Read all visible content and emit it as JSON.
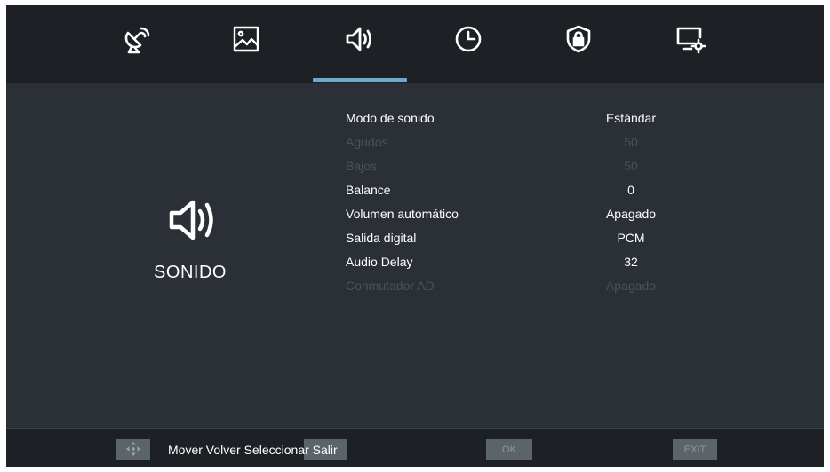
{
  "tabs": [
    {
      "icon": "satellite-dish-icon",
      "selected": false
    },
    {
      "icon": "picture-icon",
      "selected": false
    },
    {
      "icon": "speaker-icon",
      "selected": true
    },
    {
      "icon": "clock-icon",
      "selected": false
    },
    {
      "icon": "shield-lock-icon",
      "selected": false
    },
    {
      "icon": "monitor-settings-icon",
      "selected": false
    }
  ],
  "section": {
    "icon": "speaker-icon",
    "title": "SONIDO"
  },
  "menu": {
    "items": [
      {
        "label": "Modo de sonido",
        "value": "Estándar",
        "enabled": true
      },
      {
        "label": "Agudos",
        "value": "50",
        "enabled": false
      },
      {
        "label": "Bajos",
        "value": "50",
        "enabled": false
      },
      {
        "label": "Balance",
        "value": "0",
        "enabled": true
      },
      {
        "label": "Volumen automático",
        "value": "Apagado",
        "enabled": true
      },
      {
        "label": "Salida digital",
        "value": "PCM",
        "enabled": true
      },
      {
        "label": "Audio Delay",
        "value": "32",
        "enabled": true
      },
      {
        "label": "Conmutador AD",
        "value": "Apagado",
        "enabled": false
      }
    ]
  },
  "footer": {
    "hint_text": "Mover Volver  Seleccionar Salir",
    "ok_key": "OK",
    "exit_key": "EXIT"
  },
  "colors": {
    "background": "#2a3036",
    "bar": "#1d2126",
    "accent": "#6fa8c8",
    "text": "#ffffff",
    "disabled_text": "#4a525a"
  }
}
